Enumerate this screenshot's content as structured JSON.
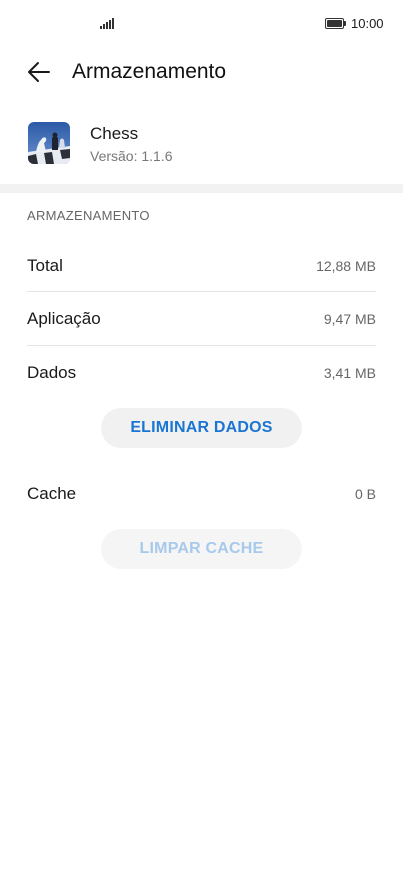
{
  "status": {
    "time": "10:00"
  },
  "header": {
    "title": "Armazenamento"
  },
  "app": {
    "name": "Chess",
    "version": "Versão: 1.1.6"
  },
  "storage": {
    "section_title": "ARMAZENAMENTO",
    "rows": [
      {
        "label": "Total",
        "value": "12,88 MB"
      },
      {
        "label": "Aplicação",
        "value": "9,47 MB"
      },
      {
        "label": "Dados",
        "value": "3,41 MB"
      }
    ],
    "clear_data_label": "ELIMINAR DADOS",
    "cache": {
      "label": "Cache",
      "value": "0 B"
    },
    "clear_cache_label": "LIMPAR CACHE"
  },
  "colors": {
    "accent": "#1a76d2",
    "accent_disabled": "#a7c9ec",
    "button_bg": "#f1f1f1"
  },
  "icons": {
    "back": "back-arrow-icon",
    "signal": "signal-icon",
    "battery": "battery-icon",
    "app": "chess-app-icon"
  }
}
